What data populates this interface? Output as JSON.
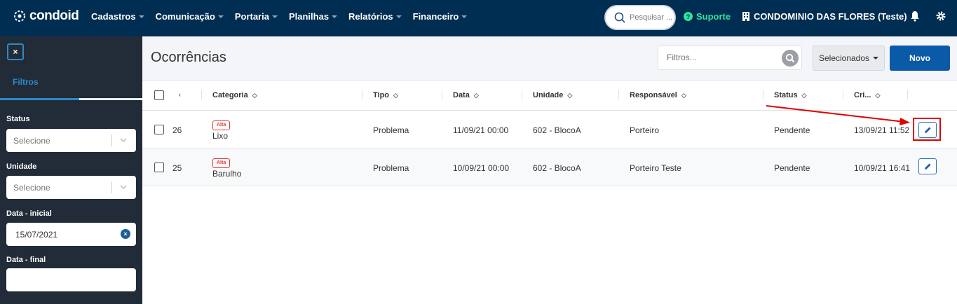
{
  "header": {
    "logo_text": "condoid",
    "nav": [
      {
        "label": "Cadastros"
      },
      {
        "label": "Comunicação"
      },
      {
        "label": "Portaria"
      },
      {
        "label": "Planilhas"
      },
      {
        "label": "Relatórios"
      },
      {
        "label": "Financeiro"
      }
    ],
    "search_placeholder": "Pesquisar ...",
    "support_label": "Suporte",
    "condo_name": "CONDOMINIO DAS FLORES (Teste)"
  },
  "sidebar": {
    "close_label": "×",
    "tab_label": "Filtros",
    "filters": {
      "status_label": "Status",
      "status_value": "Selecione",
      "unidade_label": "Unidade",
      "unidade_value": "Selecione",
      "data_inicial_label": "Data - inicial",
      "data_inicial_value": "15/07/2021",
      "data_final_label": "Data - final",
      "data_final_value": ""
    }
  },
  "main": {
    "title": "Ocorrências",
    "filter_placeholder": "Filtros...",
    "selected_button": "Selecionados",
    "new_button": "Novo"
  },
  "table": {
    "columns": [
      "Categoria",
      "Tipo",
      "Data",
      "Unidade",
      "Responsável",
      "Status",
      "Cri..."
    ],
    "rows": [
      {
        "id": "26",
        "priority": "Alta",
        "categoria": "Lixo",
        "tipo": "Problema",
        "data": "11/09/21 00:00",
        "unidade": "602 - BlocoA",
        "responsavel": "Porteiro",
        "status": "Pendente",
        "criado": "13/09/21 11:52"
      },
      {
        "id": "25",
        "priority": "Alta",
        "categoria": "Barulho",
        "tipo": "Problema",
        "data": "10/09/21 00:00",
        "unidade": "602 - BlocoA",
        "responsavel": "Porteiro Teste",
        "status": "Pendente",
        "criado": "10/09/21 16:41"
      }
    ]
  },
  "colors": {
    "topbar": "#002d52",
    "sidebar": "#222b38",
    "primary": "#0a5aa8",
    "support": "#2ee39a",
    "highlight": "#e00000"
  }
}
